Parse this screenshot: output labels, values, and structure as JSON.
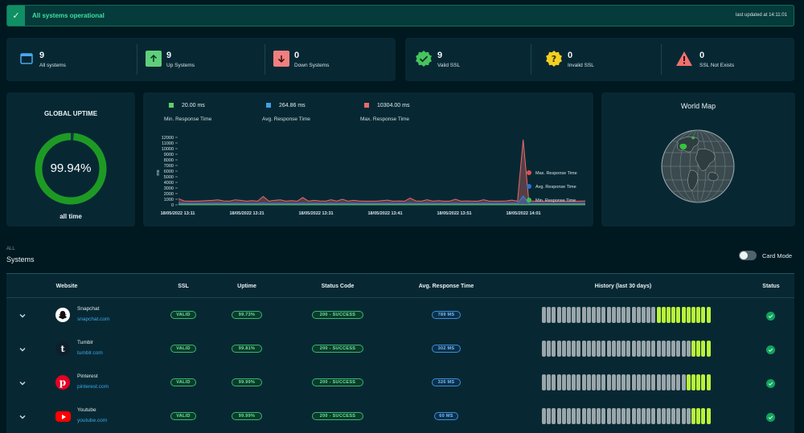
{
  "banner": {
    "text": "All systems operational",
    "updated": "last updated at 14:11:01"
  },
  "stats": [
    {
      "count": "9",
      "label": "All systems",
      "icon": "window-icon"
    },
    {
      "count": "9",
      "label": "Up Systems",
      "icon": "arrow-up-icon"
    },
    {
      "count": "0",
      "label": "Down Systems",
      "icon": "arrow-down-icon"
    },
    {
      "count": "9",
      "label": "Valid SSL",
      "icon": "check-badge-icon"
    },
    {
      "count": "0",
      "label": "Invalid SSL",
      "icon": "question-badge-icon"
    },
    {
      "count": "0",
      "label": "SSL Not Exists",
      "icon": "warning-icon"
    }
  ],
  "uptime": {
    "title": "GLOBAL UPTIME",
    "value": "99.94%",
    "percent": 99.94,
    "subtitle": "all time"
  },
  "response": {
    "min": {
      "value": "20.00 ms",
      "label": "Min. Response Time",
      "color": "#5fd068"
    },
    "avg": {
      "value": "264.86 ms",
      "label": "Avg. Response Time",
      "color": "#3fa0e6"
    },
    "max": {
      "value": "10304.00 ms",
      "label": "Max. Response Time",
      "color": "#e96a6a"
    }
  },
  "chart_data": {
    "type": "area",
    "ylabel": "ms",
    "ylim": [
      0,
      12000
    ],
    "yticks": [
      0,
      1000,
      2000,
      3000,
      4000,
      5000,
      6000,
      7000,
      8000,
      9000,
      10000,
      11000,
      12000
    ],
    "xticks": [
      "18/05/2022 13:11",
      "18/05/2022 13:21",
      "18/05/2022 13:31",
      "18/05/2022 13:41",
      "18/05/2022 13:51",
      "18/05/2022 14:01"
    ],
    "legend": [
      "Max. Response Time",
      "Avg. Response Time",
      "Min. Response Time"
    ],
    "series": [
      {
        "name": "Max. Response Time",
        "color": "#e96a6a",
        "values": [
          1100,
          700,
          650,
          650,
          700,
          750,
          800,
          900,
          700,
          650,
          900,
          800,
          650,
          750,
          650,
          1500,
          650,
          800,
          900,
          650,
          750,
          650,
          1300,
          650,
          800,
          700,
          650,
          900,
          650,
          1000,
          650,
          800,
          700,
          650,
          650,
          650,
          750,
          850,
          650,
          700,
          650,
          1200,
          700,
          650,
          900,
          650,
          750,
          650,
          650,
          1000,
          650,
          700,
          650,
          650,
          900,
          650,
          650,
          650,
          700,
          850,
          650,
          11600,
          700,
          650,
          650,
          650,
          650,
          650,
          650,
          650,
          650,
          650,
          700
        ]
      },
      {
        "name": "Avg. Response Time",
        "color": "#3f7fd6",
        "values": [
          300,
          250,
          240,
          240,
          250,
          260,
          270,
          280,
          260,
          250,
          280,
          270,
          250,
          260,
          250,
          320,
          250,
          270,
          280,
          250,
          260,
          250,
          300,
          250,
          270,
          260,
          250,
          280,
          250,
          290,
          250,
          270,
          260,
          250,
          250,
          250,
          260,
          270,
          250,
          260,
          250,
          290,
          260,
          250,
          280,
          250,
          260,
          250,
          250,
          290,
          250,
          260,
          250,
          250,
          280,
          250,
          250,
          250,
          260,
          270,
          250,
          1600,
          260,
          250,
          250,
          250,
          250,
          250,
          250,
          250,
          250,
          250,
          260
        ]
      },
      {
        "name": "Min. Response Time",
        "color": "#5fd068",
        "values": [
          30,
          20,
          20,
          20,
          20,
          20,
          20,
          20,
          20,
          20,
          20,
          20,
          20,
          20,
          20,
          20,
          20,
          20,
          20,
          20,
          20,
          20,
          20,
          20,
          20,
          20,
          20,
          20,
          20,
          20,
          20,
          20,
          20,
          20,
          20,
          20,
          20,
          20,
          20,
          20,
          20,
          20,
          20,
          20,
          20,
          20,
          20,
          20,
          20,
          20,
          20,
          20,
          20,
          20,
          20,
          20,
          20,
          20,
          20,
          20,
          20,
          20,
          20,
          20,
          20,
          20,
          20,
          20,
          20,
          20,
          20,
          20,
          20
        ]
      }
    ]
  },
  "map": {
    "title": "World Map"
  },
  "systems": {
    "section_top": "ALL",
    "section_title": "Systems",
    "card_mode_label": "Card Mode",
    "columns": [
      "Website",
      "SSL",
      "Uptime",
      "Status Code",
      "Avg. Response Time",
      "History (last 30 days)",
      "Status"
    ],
    "history_colors": {
      "gray": "#9aa6aa",
      "green": "#b8f23a"
    },
    "rows": [
      {
        "name": "Snapchat",
        "url": "snapchat.com",
        "logo": "snapchat-icon",
        "ssl": "VALID",
        "uptime": "99.73%",
        "code": "200 - SUCCESS",
        "avg": "789 MS",
        "history": [
          0,
          0,
          0,
          0,
          0,
          0,
          0,
          0,
          0,
          0,
          0,
          0,
          0,
          0,
          0,
          0,
          0,
          0,
          0,
          0,
          0,
          0,
          0,
          1,
          1,
          1,
          1,
          1,
          1,
          1,
          1,
          1,
          1,
          1
        ]
      },
      {
        "name": "Tumblr",
        "url": "tumblr.com",
        "logo": "tumblr-icon",
        "ssl": "VALID",
        "uptime": "99.81%",
        "code": "200 - SUCCESS",
        "avg": "302 MS",
        "history": [
          0,
          0,
          0,
          0,
          0,
          0,
          0,
          0,
          0,
          0,
          0,
          0,
          0,
          0,
          0,
          0,
          0,
          0,
          0,
          0,
          0,
          0,
          0,
          0,
          0,
          0,
          0,
          0,
          0,
          0,
          1,
          1,
          1,
          1
        ]
      },
      {
        "name": "Pinterest",
        "url": "pinterest.com",
        "logo": "pinterest-icon",
        "ssl": "VALID",
        "uptime": "99.99%",
        "code": "200 - SUCCESS",
        "avg": "326 MS",
        "history": [
          0,
          0,
          0,
          0,
          0,
          0,
          0,
          0,
          0,
          0,
          0,
          0,
          0,
          0,
          0,
          0,
          0,
          0,
          0,
          0,
          0,
          0,
          0,
          0,
          0,
          0,
          0,
          0,
          0,
          1,
          1,
          1,
          1,
          1
        ]
      },
      {
        "name": "Youtube",
        "url": "youtube.com",
        "logo": "youtube-icon",
        "ssl": "VALID",
        "uptime": "99.99%",
        "code": "200 - SUCCESS",
        "avg": "60 MS",
        "history": [
          0,
          0,
          0,
          0,
          0,
          0,
          0,
          0,
          0,
          0,
          0,
          0,
          0,
          0,
          0,
          0,
          0,
          0,
          0,
          0,
          0,
          0,
          0,
          0,
          0,
          0,
          0,
          0,
          0,
          0,
          1,
          1,
          1,
          1
        ]
      }
    ]
  }
}
